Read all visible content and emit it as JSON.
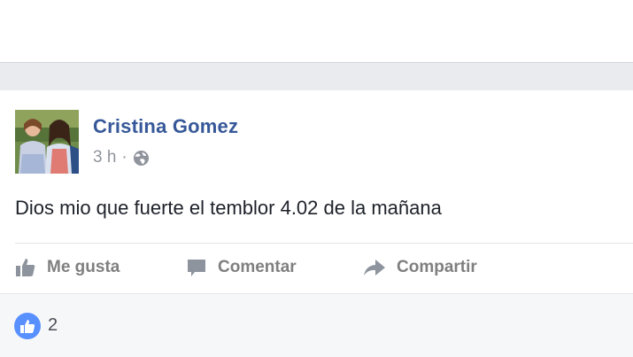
{
  "post": {
    "author": "Cristina Gomez",
    "time": "3 h",
    "separator": "·",
    "privacy_icon": "globe-icon",
    "text": "Dios mio que fuerte el temblor 4.02 de la mañana"
  },
  "actions": {
    "like_label": "Me gusta",
    "comment_label": "Comentar",
    "share_label": "Compartir"
  },
  "reactions": {
    "like_count": "2"
  },
  "colors": {
    "author_link": "#365899",
    "meta_gray": "#90949c",
    "action_gray": "#7f7f7f",
    "like_blue": "#5890ff",
    "page_band": "#e9ebee"
  }
}
